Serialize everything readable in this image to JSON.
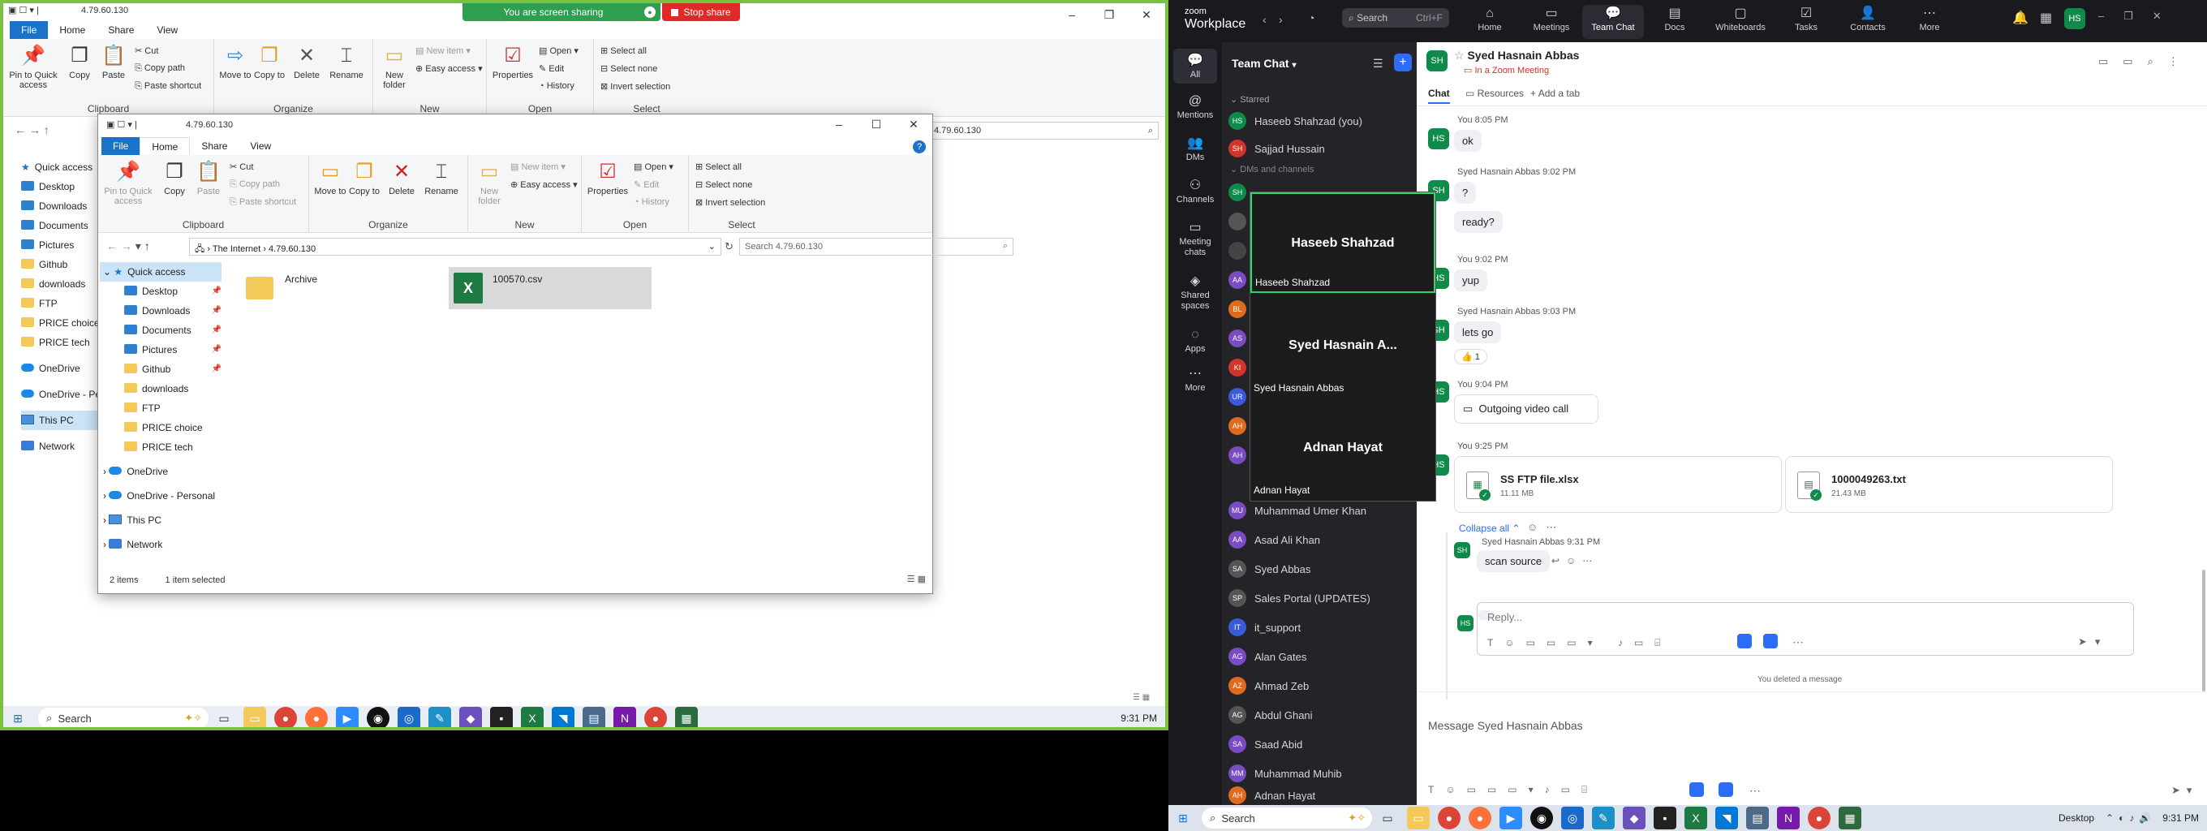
{
  "left_screen": {
    "share_banner": {
      "text": "You are screen sharing",
      "stop": "Stop share"
    },
    "back_window": {
      "title": "4.79.60.130",
      "tabs": [
        "File",
        "Home",
        "Share",
        "View"
      ],
      "ribbon": {
        "clipboard": {
          "pin": "Pin to Quick access",
          "copy": "Copy",
          "paste": "Paste",
          "cut": "Cut",
          "copy_path": "Copy path",
          "paste_shortcut": "Paste shortcut",
          "label": "Clipboard"
        },
        "organize": {
          "move": "Move to",
          "copy": "Copy to",
          "delete": "Delete",
          "rename": "Rename",
          "label": "Organize"
        },
        "new": {
          "new_folder": "New folder",
          "new_item": "New item",
          "easy_access": "Easy access",
          "label": "New"
        },
        "open": {
          "properties": "Properties",
          "open": "Open",
          "edit": "Edit",
          "history": "History",
          "label": "Open"
        },
        "select": {
          "all": "Select all",
          "none": "Select none",
          "invert": "Invert selection",
          "label": "Select"
        }
      },
      "address": "4.79.60.130",
      "nav": [
        "Quick access",
        "Desktop",
        "Downloads",
        "Documents",
        "Pictures",
        "Github",
        "downloads",
        "FTP",
        "PRICE choice",
        "PRICE tech",
        "OneDrive",
        "OneDrive - Pe",
        "This PC",
        "Network"
      ]
    },
    "front_window": {
      "title": "4.79.60.130",
      "tabs": [
        "File",
        "Home",
        "Share",
        "View"
      ],
      "ribbon": {
        "clipboard": {
          "pin": "Pin to Quick access",
          "copy": "Copy",
          "paste": "Paste",
          "cut": "Cut",
          "copy_path": "Copy path",
          "paste_shortcut": "Paste shortcut",
          "label": "Clipboard"
        },
        "organize": {
          "move": "Move to",
          "copy": "Copy to",
          "delete": "Delete",
          "rename": "Rename",
          "label": "Organize"
        },
        "new": {
          "new_folder": "New folder",
          "new_item": "New item",
          "easy_access": "Easy access",
          "label": "New"
        },
        "open": {
          "properties": "Properties",
          "open": "Open",
          "edit": "Edit",
          "history": "History",
          "label": "Open"
        },
        "select": {
          "all": "Select all",
          "none": "Select none",
          "invert": "Invert selection",
          "label": "Select"
        }
      },
      "path": [
        "The Internet",
        "4.79.60.130"
      ],
      "search_placeholder": "Search 4.79.60.130",
      "nav": {
        "quick_access": "Quick access",
        "pinned": [
          "Desktop",
          "Downloads",
          "Documents",
          "Pictures",
          "Github"
        ],
        "folders": [
          "downloads",
          "FTP",
          "PRICE choice",
          "PRICE tech"
        ],
        "onedrive": "OneDrive",
        "onedrive_personal": "OneDrive - Personal",
        "this_pc": "This PC",
        "network": "Network"
      },
      "files": [
        {
          "name": "Archive",
          "type": "folder"
        },
        {
          "name": "100570.csv",
          "type": "excel"
        }
      ],
      "status": {
        "items": "2 items",
        "selected": "1 item selected"
      }
    },
    "taskbar": {
      "search": "Search",
      "time": "9:31 PM"
    }
  },
  "zoom": {
    "brand": {
      "line1": "zoom",
      "line2": "Workplace"
    },
    "search": {
      "label": "Search",
      "shortcut": "Ctrl+F"
    },
    "tabs": [
      "Home",
      "Meetings",
      "Team Chat",
      "Docs",
      "Whiteboards",
      "Tasks",
      "Contacts",
      "More"
    ],
    "rail": [
      "All",
      "Mentions",
      "DMs",
      "Channels",
      "Meeting chats",
      "Shared spaces",
      "Apps",
      "More"
    ],
    "list_title": "Team Chat",
    "starred_label": "Starred",
    "dms_label": "DMs and channels",
    "starred": [
      {
        "name": "Haseeb Shahzad (you)",
        "initials": "HS",
        "color": "#0f8a4b"
      },
      {
        "name": "Sajjad Hussain",
        "initials": "SH",
        "color": "#d0342c"
      }
    ],
    "contacts": [
      {
        "name": "Muhammad Umer Khan",
        "initials": "MU",
        "color": "#7a4cc2"
      },
      {
        "name": "Asad Ali Khan",
        "initials": "AA",
        "color": "#7a4cc2"
      },
      {
        "name": "Syed Abbas",
        "initials": "SA",
        "color": "#555"
      },
      {
        "name": "Sales Portal (UPDATES)",
        "initials": "SP",
        "color": "#555"
      },
      {
        "name": "it_support",
        "initials": "IT",
        "color": "#3a5bd9"
      },
      {
        "name": "Alan Gates",
        "initials": "AG",
        "color": "#7a4cc2"
      },
      {
        "name": "Ahmad Zeb",
        "initials": "AZ",
        "color": "#e06b1f"
      },
      {
        "name": "Abdul Ghani",
        "initials": "AG",
        "color": "#555"
      },
      {
        "name": "Saad Abid",
        "initials": "SA",
        "color": "#7a4cc2"
      },
      {
        "name": "Muhammad Muhib",
        "initials": "MM",
        "color": "#7a4cc2"
      },
      {
        "name": "Adnan Hayat",
        "initials": "AH",
        "color": "#e06b1f"
      }
    ],
    "hidden_avatars": [
      "SH",
      "",
      "",
      "AA",
      "BL",
      "AS",
      "KI",
      "UR",
      "AH",
      "AH"
    ],
    "overlay": [
      {
        "big": "Haseeb Shahzad",
        "small": "Haseeb Shahzad"
      },
      {
        "big": "Syed Hasnain A...",
        "small": "Syed Hasnain Abbas"
      },
      {
        "big": "Adnan Hayat",
        "small": "Adnan Hayat"
      }
    ],
    "chat": {
      "name": "Syed Hasnain Abbas",
      "status": "In a Zoom Meeting",
      "header_tabs": [
        "Chat",
        "Resources",
        "Add a tab"
      ],
      "messages": [
        {
          "author": "You 8:05 PM",
          "text": "ok",
          "av": "HS"
        },
        {
          "author": "Syed Hasnain Abbas 9:02 PM",
          "text": "?",
          "av": "SH"
        },
        {
          "author": "",
          "text": "ready?",
          "av": ""
        },
        {
          "author": "You 9:02 PM",
          "text": "yup",
          "av": "HS"
        },
        {
          "author": "Syed Hasnain Abbas 9:03 PM",
          "text": "lets go",
          "av": "SH"
        },
        {
          "author": "You 9:04 PM",
          "text": "Outgoing video call",
          "av": "HS"
        },
        {
          "author": "You 9:25 PM",
          "text": "",
          "av": "HS"
        }
      ],
      "reaction": "👍 1",
      "files": [
        {
          "name": "SS FTP file.xlsx",
          "size": "11.11 MB"
        },
        {
          "name": "1000049263.txt",
          "size": "21.43 MB"
        }
      ],
      "collapse": "Collapse all",
      "thread": {
        "author": "Syed Hasnain Abbas 9:31 PM",
        "text": "scan source"
      },
      "reply_placeholder": "Reply...",
      "deleted": "You deleted a message",
      "message_placeholder": "Message Syed Hasnain Abbas"
    },
    "taskbar": {
      "search": "Search",
      "desktop": "Desktop",
      "time": "9:31 PM"
    }
  }
}
